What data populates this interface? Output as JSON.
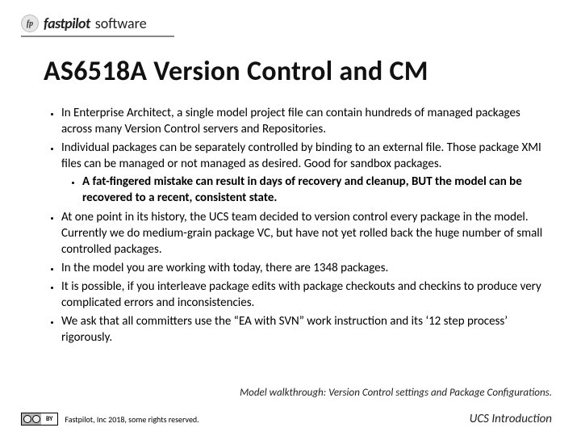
{
  "logo": {
    "mark": "fp",
    "name": "fastpilot",
    "suffix": "software"
  },
  "title": "AS6518A Version Control and CM",
  "bullets": {
    "b1": "In Enterprise Architect, a single model project file can contain hundreds of managed packages across many Version Control servers and Repositories.",
    "b2": "Individual packages can be separately controlled by binding to an external file. Those package XMI files can be managed or not managed as desired. Good for sandbox packages.",
    "b2a": "A fat-fingered mistake can result in days of recovery and cleanup, BUT the model can be recovered to a recent, consistent state.",
    "b3": "At one point in its history, the UCS team decided to version control every package in the model. Currently we do medium-grain package VC, but have not yet rolled back the huge number of small controlled packages.",
    "b4": "In the model you are working with today, there are 1348 packages.",
    "b5": "It is possible, if you interleave package edits with package checkouts and checkins to produce very complicated errors and inconsistencies.",
    "b6": "We ask that all committers use the “EA with SVN” work instruction and its ‘12 step process’ rigorously."
  },
  "walkthrough": "Model walkthrough: Version Control settings and Package Configurations.",
  "footer": {
    "cc": "BY",
    "copyright": "Fastpilot, Inc 2018, some rights reserved.",
    "right": "UCS Introduction"
  }
}
